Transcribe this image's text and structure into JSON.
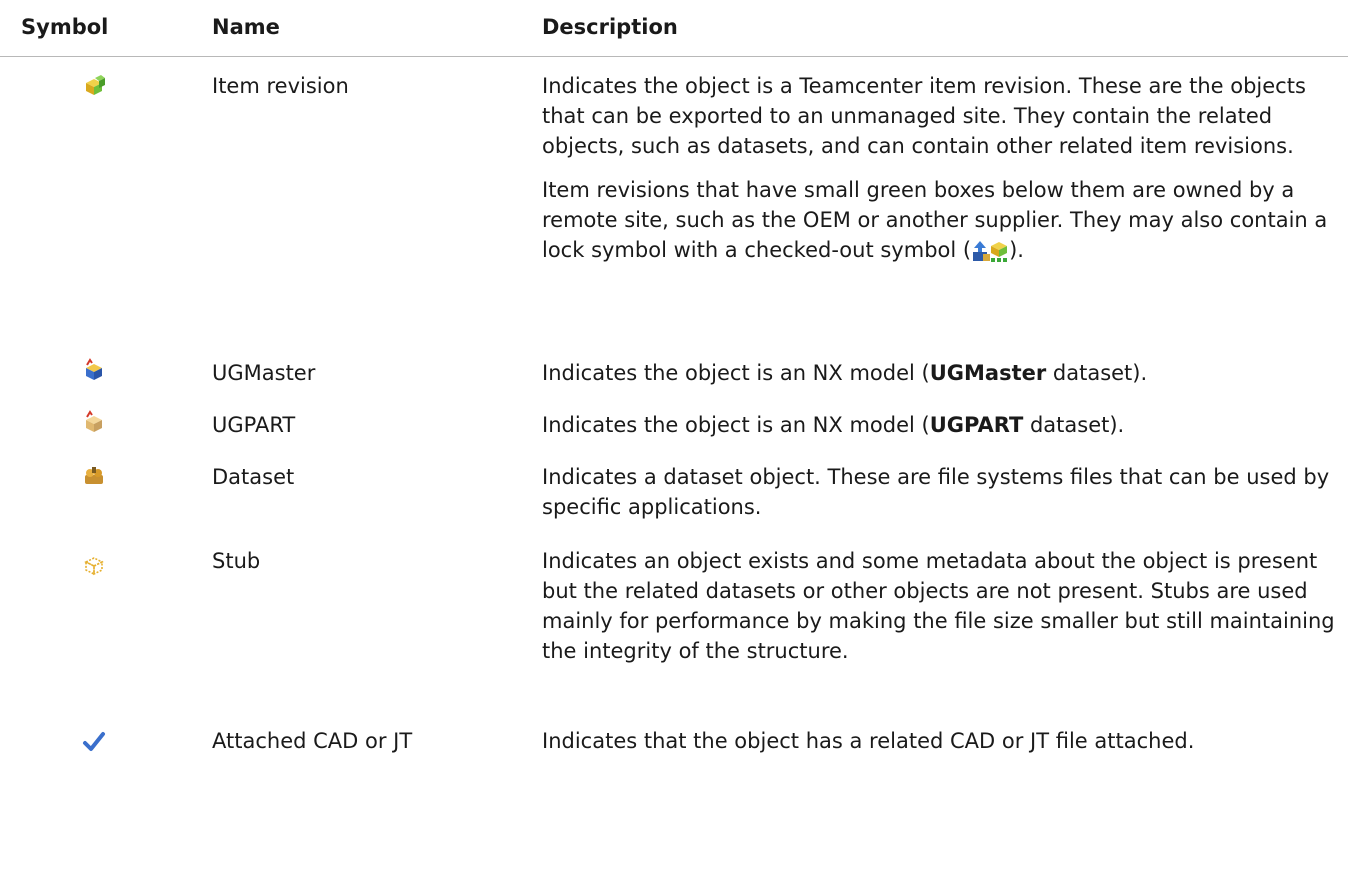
{
  "headers": {
    "symbol": "Symbol",
    "name": "Name",
    "description": "Description"
  },
  "rows": [
    {
      "icon": "item-revision-icon",
      "name": "Item revision",
      "p1": "Indicates the object is a Teamcenter item revision. These are the objects that can be exported to an unmanaged site. They contain the related objects, such as datasets, and can contain other related item revisions.",
      "p2": "Item revisions that have small green boxes below them are owned by a remote site, such as the OEM or another supplier. They may also contain a lock symbol with a checked-out symbol (",
      "p2_end": ")."
    },
    {
      "icon": "ugmaster-icon",
      "name": "UGMaster",
      "pre": "Indicates the object is an NX model (",
      "bold": "UGMaster",
      "post": " dataset)."
    },
    {
      "icon": "ugpart-icon",
      "name": "UGPART",
      "pre": "Indicates the object is an NX model (",
      "bold": "UGPART",
      "post": " dataset)."
    },
    {
      "icon": "dataset-icon",
      "name": "Dataset",
      "text": "Indicates a dataset object. These are file systems files that can be used by specific applications."
    },
    {
      "icon": "stub-icon",
      "name": "Stub",
      "text": "Indicates an object exists and some metadata about the object is present but the related datasets or other objects are not present. Stubs are used mainly for performance by making the file size smaller but still maintaining the integrity of the structure."
    },
    {
      "icon": "checkmark-icon",
      "name": "Attached CAD or JT",
      "text": "Indicates that the object has a related CAD or JT file attached."
    }
  ]
}
